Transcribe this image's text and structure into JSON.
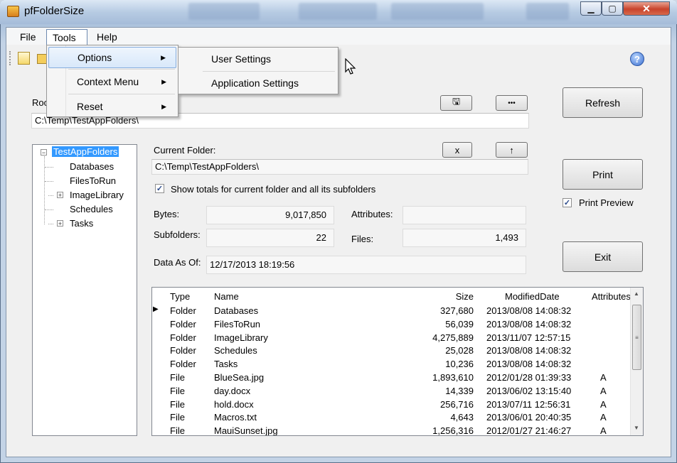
{
  "window": {
    "title": "pfFolderSize",
    "min_label": "▁",
    "max_label": "▢",
    "close_label": "✕"
  },
  "menubar": {
    "file": "File",
    "tools": "Tools",
    "help": "Help"
  },
  "tools_menu": {
    "options": "Options",
    "context_menu": "Context Menu",
    "reset": "Reset"
  },
  "options_submenu": {
    "user_settings": "User Settings",
    "application_settings": "Application Settings"
  },
  "toolbar": {
    "help_label": "?"
  },
  "root": {
    "label_partial": "Roo",
    "path": "C:\\Temp\\TestAppFolders\\",
    "save_label": "🖫",
    "browse_label": "•••"
  },
  "buttons": {
    "refresh": "Refresh",
    "print": "Print",
    "exit": "Exit",
    "clear": "x",
    "up": "↑"
  },
  "print_preview": {
    "label": "Print Preview",
    "checked": "✓"
  },
  "tree": {
    "root": "TestAppFolders",
    "children": [
      {
        "label": "Databases",
        "expander": ""
      },
      {
        "label": "FilesToRun",
        "expander": ""
      },
      {
        "label": "ImageLibrary",
        "expander": "+"
      },
      {
        "label": "Schedules",
        "expander": ""
      },
      {
        "label": "Tasks",
        "expander": "+"
      }
    ],
    "root_expander": "−"
  },
  "current_folder": {
    "label": "Current Folder:",
    "path": "C:\\Temp\\TestAppFolders\\"
  },
  "show_totals": {
    "label": "Show totals for current folder and all its subfolders",
    "checked": "✓"
  },
  "stats": {
    "bytes_label": "Bytes:",
    "bytes_value": "9,017,850",
    "attributes_label": "Attributes:",
    "attributes_value": "",
    "subfolders_label": "Subfolders:",
    "subfolders_value": "22",
    "files_label": "Files:",
    "files_value": "1,493",
    "data_as_of_label": "Data As Of:",
    "data_as_of_value": "12/17/2013 18:19:56"
  },
  "grid": {
    "headers": {
      "type": "Type",
      "name": "Name",
      "size": "Size",
      "modified": "ModifiedDate",
      "attributes": "Attributes"
    },
    "current_row_marker": "▶",
    "rows": [
      {
        "type": "Folder",
        "name": "Databases",
        "size": "327,680",
        "modified": "2013/08/08 14:08:32",
        "attributes": ""
      },
      {
        "type": "Folder",
        "name": "FilesToRun",
        "size": "56,039",
        "modified": "2013/08/08 14:08:32",
        "attributes": ""
      },
      {
        "type": "Folder",
        "name": "ImageLibrary",
        "size": "4,275,889",
        "modified": "2013/11/07 12:57:15",
        "attributes": ""
      },
      {
        "type": "Folder",
        "name": "Schedules",
        "size": "25,028",
        "modified": "2013/08/08 14:08:32",
        "attributes": ""
      },
      {
        "type": "Folder",
        "name": "Tasks",
        "size": "10,236",
        "modified": "2013/08/08 14:08:32",
        "attributes": ""
      },
      {
        "type": "File",
        "name": "BlueSea.jpg",
        "size": "1,893,610",
        "modified": "2012/01/28 01:39:33",
        "attributes": "A"
      },
      {
        "type": "File",
        "name": "day.docx",
        "size": "14,339",
        "modified": "2013/06/02 13:15:40",
        "attributes": "A"
      },
      {
        "type": "File",
        "name": "hold.docx",
        "size": "256,716",
        "modified": "2013/07/11 12:56:31",
        "attributes": "A"
      },
      {
        "type": "File",
        "name": "Macros.txt",
        "size": "4,643",
        "modified": "2013/06/01 20:40:35",
        "attributes": "A"
      },
      {
        "type": "File",
        "name": "MauiSunset.jpg",
        "size": "1,256,316",
        "modified": "2012/01/27 21:46:27",
        "attributes": "A"
      }
    ],
    "scroll_up": "▲",
    "scroll_down": "▼",
    "thumb_grip": "≡"
  }
}
